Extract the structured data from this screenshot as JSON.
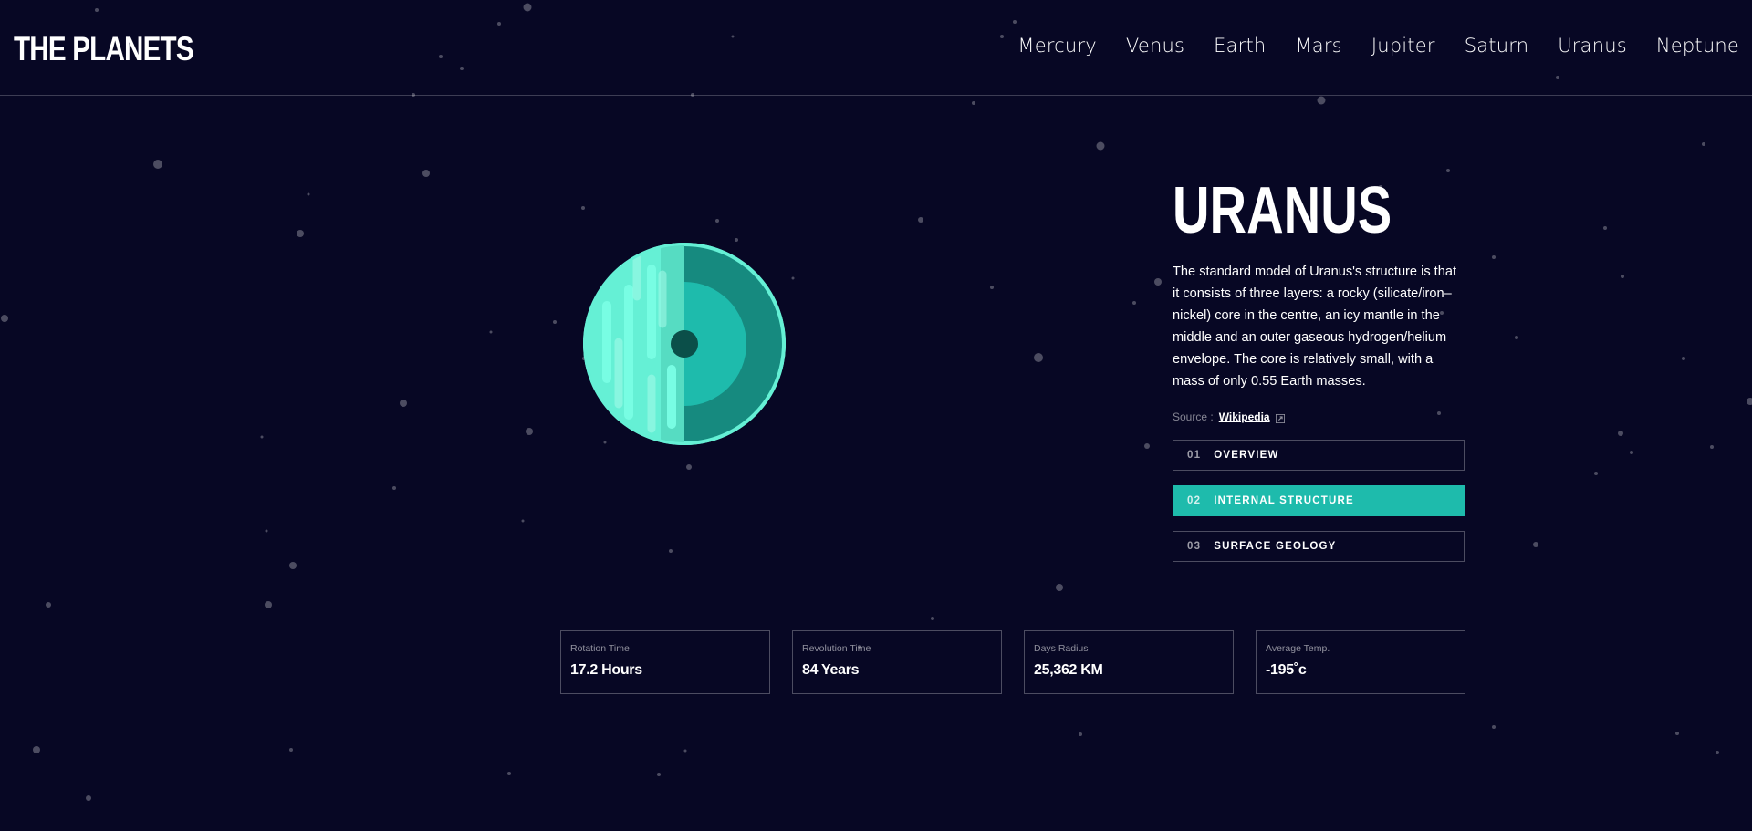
{
  "header": {
    "logo": "THE PLANETS",
    "nav": [
      "Mercury",
      "Venus",
      "Earth",
      "Mars",
      "Jupiter",
      "Saturn",
      "Uranus",
      "Neptune"
    ]
  },
  "planet": {
    "name": "URANUS",
    "description": "The standard model of Uranus's structure is that it consists of three layers: a rocky (silicate/iron–nickel) core in the centre, an icy mantle in the middle and an outer gaseous hydrogen/helium envelope. The core is relatively small, with a mass of only 0.55 Earth masses.",
    "source_label": "Source :",
    "source_link": "Wikipedia",
    "image_icon": "uranus-internal-structure-icon"
  },
  "tabs": [
    {
      "num": "01",
      "label": "OVERVIEW",
      "active": false
    },
    {
      "num": "02",
      "label": "INTERNAL STRUCTURE",
      "active": true
    },
    {
      "num": "03",
      "label": "SURFACE GEOLOGY",
      "active": false
    }
  ],
  "stats": [
    {
      "label": "Rotation Time",
      "value": "17.2 Hours"
    },
    {
      "label": "Revolution Time",
      "value": "84 Years"
    },
    {
      "label": "Days Radius",
      "value": "25,362 KM"
    },
    {
      "label": "Average Temp.",
      "value": "-195˚c"
    }
  ],
  "colors": {
    "background": "#070724",
    "accent": "#1ebbac",
    "planet_light": "#65f0d5",
    "planet_mid": "#1ebbac",
    "planet_dark": "#168a7f",
    "planet_core": "#0b4f49"
  }
}
